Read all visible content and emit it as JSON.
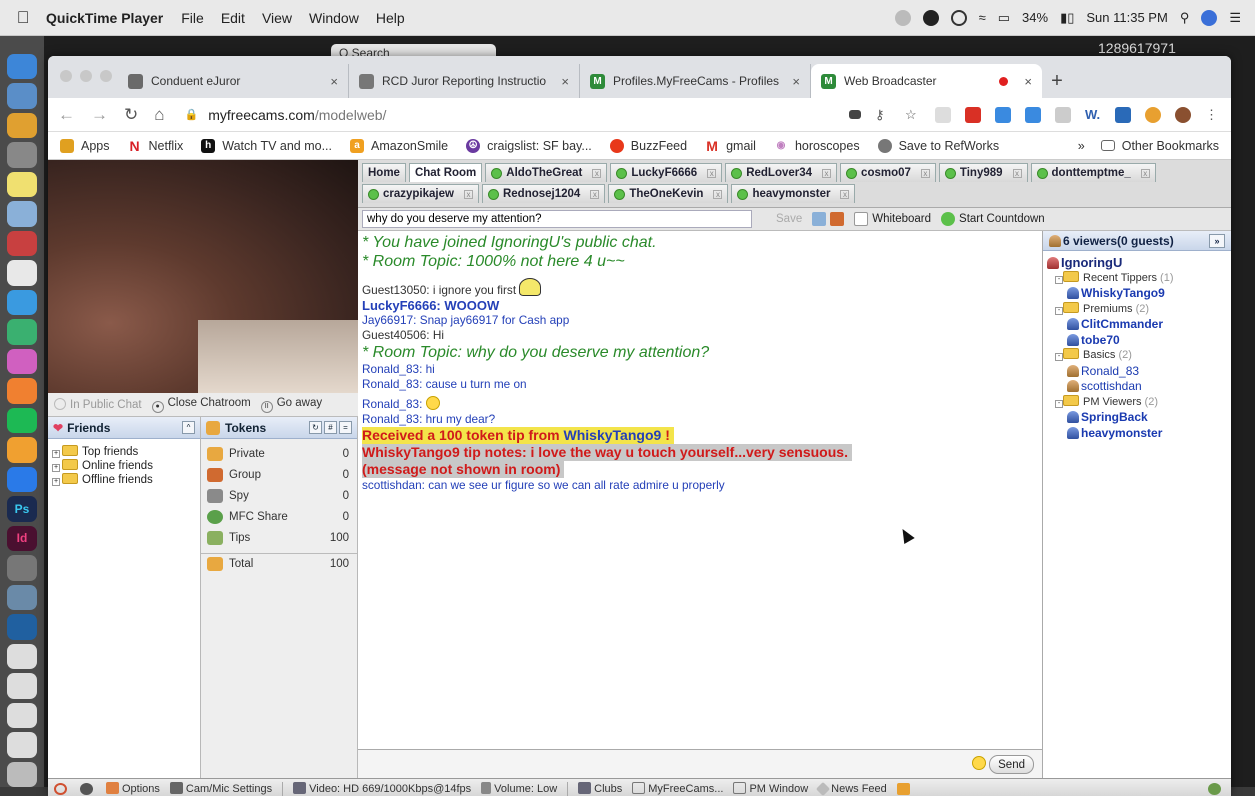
{
  "menubar": {
    "app_name": "QuickTime Player",
    "menus": [
      "File",
      "Edit",
      "View",
      "Window",
      "Help"
    ],
    "battery": "34%",
    "clock": "Sun 11:35 PM"
  },
  "qt": {
    "search_label": "Q Search",
    "phone_number": "1289617971"
  },
  "browser": {
    "tabs": [
      {
        "title": "Conduent eJuror",
        "fav_color": "#6a6a6a"
      },
      {
        "title": "RCD Juror Reporting Instructio",
        "fav_color": "#777777"
      },
      {
        "title": "Profiles.MyFreeCams - Profiles",
        "fav_color": "#2e8b3a"
      },
      {
        "title": "Web Broadcaster",
        "fav_color": "#2e8b3a"
      }
    ],
    "url_host": "myfreecams.com",
    "url_path": "/modelweb/",
    "bookmarks": [
      {
        "label": "Apps",
        "color": "#e0a020"
      },
      {
        "label": "Netflix",
        "color": "#d81f26"
      },
      {
        "label": "Watch TV and mo...",
        "color": "#111111"
      },
      {
        "label": "AmazonSmile",
        "color": "#f0a020"
      },
      {
        "label": "craigslist: SF bay...",
        "color": "#6a3aa0"
      },
      {
        "label": "BuzzFeed",
        "color": "#e8381a"
      },
      {
        "label": "gmail",
        "color": "#d93025"
      },
      {
        "label": "horoscopes",
        "color": "#c080c0"
      },
      {
        "label": "Save to RefWorks",
        "color": "#777777"
      }
    ],
    "bookmarks_more": "»",
    "other_bookmarks": "Other Bookmarks"
  },
  "left": {
    "in_public_chat": "In Public Chat",
    "close_chatroom": "Close Chatroom",
    "go_away": "Go away",
    "friends_title": "Friends",
    "friend_groups": [
      "Top friends",
      "Online friends",
      "Offline friends"
    ],
    "tokens_title": "Tokens",
    "token_rows": [
      {
        "label": "Private",
        "value": "0",
        "color": "#e8a840"
      },
      {
        "label": "Group",
        "value": "0",
        "color": "#d06a30"
      },
      {
        "label": "Spy",
        "value": "0",
        "color": "#8a8a8a"
      },
      {
        "label": "MFC Share",
        "value": "0",
        "color": "#5aa04a"
      },
      {
        "label": "Tips",
        "value": "100",
        "color": "#8ab060"
      }
    ],
    "token_total": {
      "label": "Total",
      "value": "100"
    }
  },
  "chat_tabs": {
    "row1": [
      "Home",
      "Chat Room",
      "AldoTheGreat",
      "LuckyF6666",
      "RedLover34",
      "cosmo07",
      "Tiny989",
      "donttemptme_"
    ],
    "row2": [
      "crazypikajew",
      "Rednosej1204",
      "TheOneKevin",
      "heavymonster"
    ]
  },
  "topic": {
    "value": "why do you deserve my attention?",
    "save": "Save",
    "whiteboard": "Whiteboard",
    "start_countdown": "Start Countdown"
  },
  "chat": {
    "joined": "* You have joined IgnoringU's public chat.",
    "topic1": "* Room Topic: 1000% not here 4 u~~",
    "l1": "Guest13050: i ignore you first",
    "l2": "LuckyF6666: WOOOW",
    "l3": "Jay66917: Snap jay66917 for Cash app",
    "l4": "Guest40506: Hi",
    "topic2": "* Room Topic: why do you deserve my attention?",
    "l5": "Ronald_83: hi",
    "l6": "Ronald_83: cause u turn me on",
    "l7": "Ronald_83:",
    "l8": "Ronald_83: hru my dear?",
    "tip_prefix": "Received a 100 token tip from",
    "tip_name": "WhiskyTango9",
    "tip_suffix": "!",
    "tipnote1": "WhiskyTango9 tip notes: i love the way u touch yourself...very sensuous.",
    "tipnote2": "(message not shown in room)",
    "l9": "scottishdan: can we see ur figure so we can all rate admire u properly"
  },
  "send_label": "Send",
  "viewers": {
    "title": "6 viewers(0 guests)",
    "host": "IgnoringU",
    "groups": [
      {
        "label": "Recent Tippers",
        "count": "(1)",
        "users": [
          {
            "name": "WhiskyTango9",
            "bold": true
          }
        ]
      },
      {
        "label": "Premiums",
        "count": "(2)",
        "users": [
          {
            "name": "ClitCmmander",
            "bold": true
          },
          {
            "name": "tobe70",
            "bold": true
          }
        ]
      },
      {
        "label": "Basics",
        "count": "(2)",
        "users": [
          {
            "name": "Ronald_83",
            "bold": false
          },
          {
            "name": "scottishdan",
            "bold": false
          }
        ]
      },
      {
        "label": "PM Viewers",
        "count": "(2)",
        "users": [
          {
            "name": "SpringBack",
            "bold": true
          },
          {
            "name": "heavymonster",
            "bold": true
          }
        ]
      }
    ]
  },
  "statusbar": {
    "options": "Options",
    "cam": "Cam/Mic Settings",
    "video": "Video: HD 669/1000Kbps@14fps",
    "volume": "Volume: Low",
    "clubs": "Clubs",
    "myfreecams": "MyFreeCams...",
    "pm": "PM Window",
    "news": "News Feed"
  }
}
